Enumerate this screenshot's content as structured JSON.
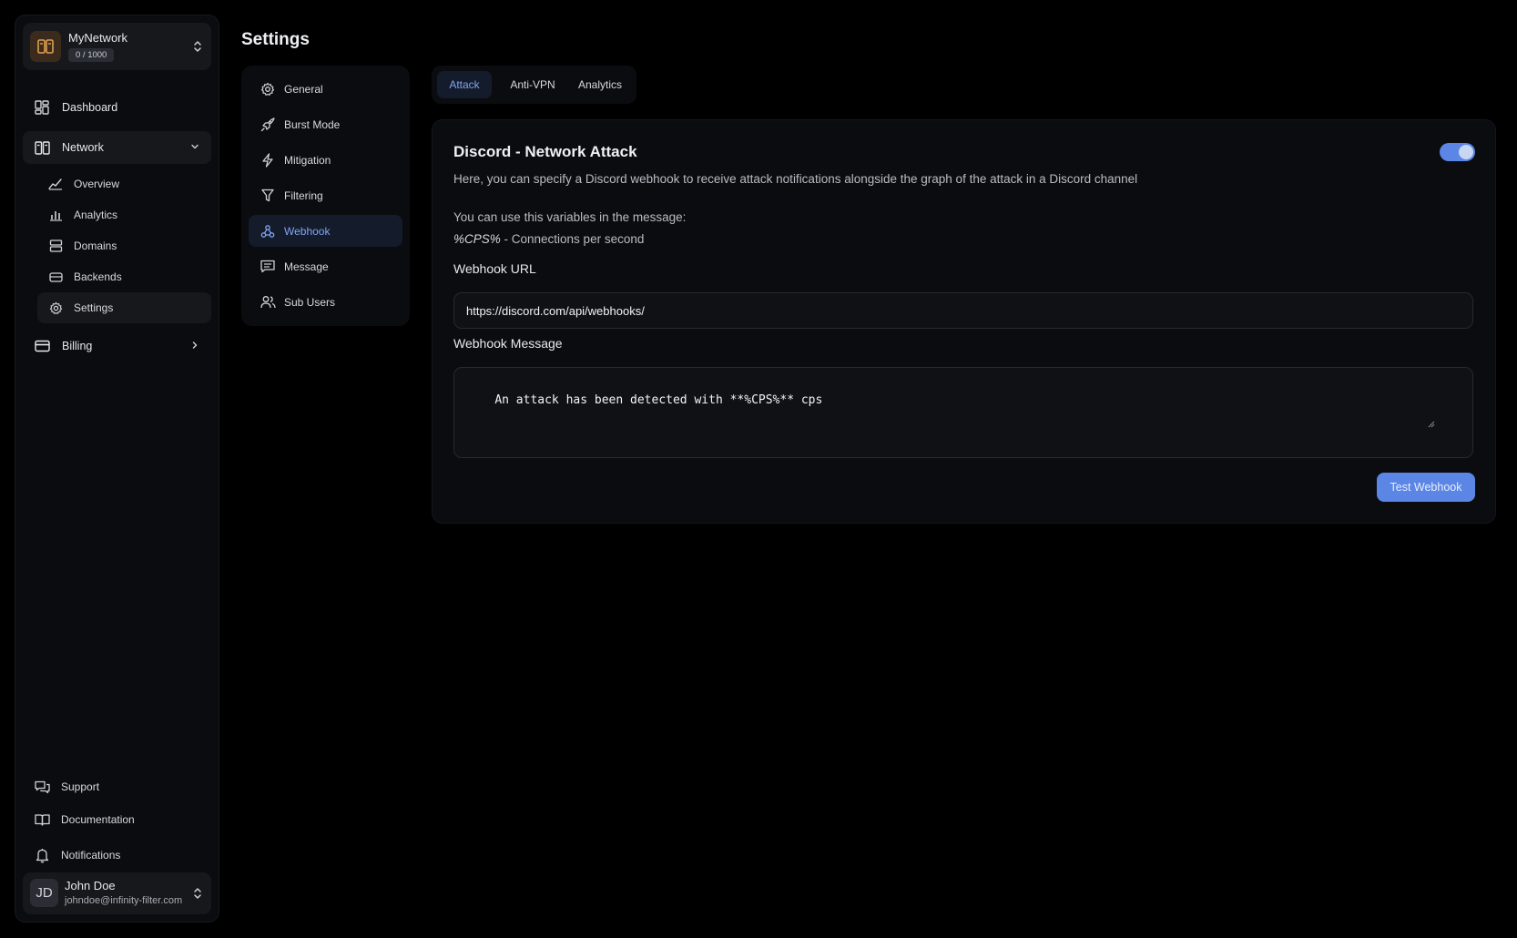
{
  "sidebar": {
    "network_switcher": {
      "name": "MyNetwork",
      "usage": "0 / 1000"
    },
    "items": [
      {
        "label": "Dashboard"
      },
      {
        "label": "Network"
      },
      {
        "label": "Billing"
      }
    ],
    "network_sub_items": [
      {
        "label": "Overview"
      },
      {
        "label": "Analytics"
      },
      {
        "label": "Domains"
      },
      {
        "label": "Backends"
      },
      {
        "label": "Settings"
      }
    ],
    "footer_items": [
      {
        "label": "Support"
      },
      {
        "label": "Documentation"
      },
      {
        "label": "Notifications"
      }
    ],
    "user": {
      "initials": "JD",
      "name": "John Doe",
      "email": "johndoe@infinity-filter.com"
    }
  },
  "page": {
    "title": "Settings"
  },
  "settings_nav": [
    {
      "label": "General"
    },
    {
      "label": "Burst Mode"
    },
    {
      "label": "Mitigation"
    },
    {
      "label": "Filtering"
    },
    {
      "label": "Webhook"
    },
    {
      "label": "Message"
    },
    {
      "label": "Sub Users"
    }
  ],
  "tabs": [
    {
      "label": "Attack"
    },
    {
      "label": "Anti-VPN"
    },
    {
      "label": "Analytics"
    }
  ],
  "card": {
    "title": "Discord - Network Attack",
    "enabled": true,
    "description": "Here, you can specify a Discord webhook to receive attack notifications alongside the graph of the attack in a Discord channel",
    "vars_intro": "You can use this variables in the message:",
    "var_name": "%CPS%",
    "var_desc": " - Connections per second",
    "url_label": "Webhook URL",
    "url_value": "https://discord.com/api/webhooks/",
    "message_label": "Webhook Message",
    "message_value": "An attack has been detected with **%CPS%** cps",
    "test_button": "Test Webhook"
  },
  "colors": {
    "accent": "#5b86e5",
    "active_text": "#7fa5f3",
    "background": "#000000",
    "panel": "#0b0c0f",
    "network_logo": "#e0a050"
  },
  "icons": {
    "dashboard": "grid-icon",
    "network": "server-icon",
    "overview": "trend-icon",
    "analytics": "bar-chart-icon",
    "domains": "database-icon",
    "backends": "wallet-icon",
    "settings": "gear-icon",
    "billing": "credit-card-icon",
    "support": "chat-icon",
    "documentation": "book-icon",
    "notifications": "bell-icon"
  }
}
